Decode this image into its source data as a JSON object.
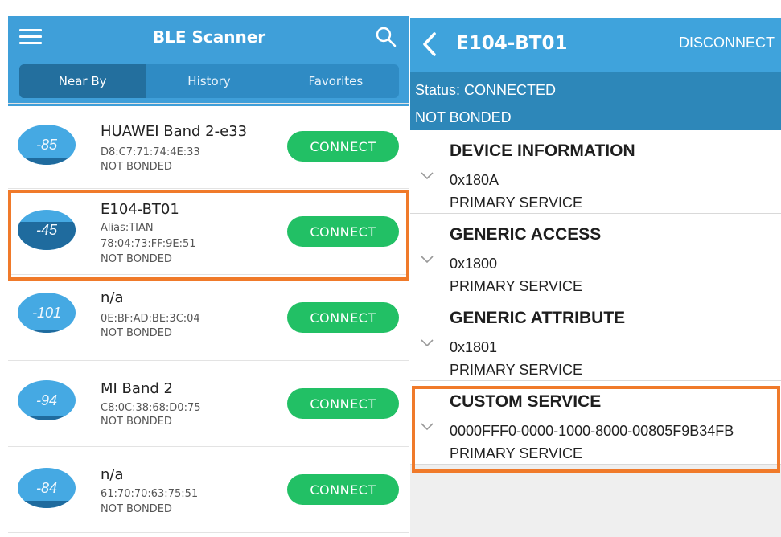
{
  "left_panel": {
    "app_title": "BLE Scanner",
    "tabs": [
      {
        "label": "Near By",
        "active": true
      },
      {
        "label": "History",
        "active": false
      },
      {
        "label": "Favorites",
        "active": false
      }
    ],
    "devices": [
      {
        "rssi": "-85",
        "name": "HUAWEI Band 2-e33",
        "lines": [
          "D8:C7:71:74:4E:33",
          "NOT BONDED"
        ],
        "button": "CONNECT"
      },
      {
        "rssi": "-45",
        "name": "E104-BT01",
        "lines": [
          "Alias:TIAN",
          "78:04:73:FF:9E:51",
          "NOT BONDED"
        ],
        "button": "CONNECT",
        "highlighted": true
      },
      {
        "rssi": "-101",
        "name": "n/a",
        "lines": [
          "0E:BF:AD:BE:3C:04",
          "NOT BONDED"
        ],
        "button": "CONNECT"
      },
      {
        "rssi": "-94",
        "name": "MI Band 2",
        "lines": [
          "C8:0C:38:68:D0:75",
          "NOT BONDED"
        ],
        "button": "CONNECT"
      },
      {
        "rssi": "-84",
        "name": "n/a",
        "lines": [
          "61:70:70:63:75:51",
          "NOT BONDED"
        ],
        "button": "CONNECT"
      }
    ]
  },
  "right_panel": {
    "device_title": "E104-BT01",
    "disconnect_label": "DISCONNECT",
    "status": "Status: CONNECTED",
    "bond": "NOT BONDED",
    "services": [
      {
        "title": "DEVICE INFORMATION",
        "uuid": "0x180A",
        "type": "PRIMARY SERVICE"
      },
      {
        "title": "GENERIC ACCESS",
        "uuid": "0x1800",
        "type": "PRIMARY SERVICE"
      },
      {
        "title": "GENERIC ATTRIBUTE",
        "uuid": "0x1801",
        "type": "PRIMARY SERVICE"
      },
      {
        "title": "CUSTOM SERVICE",
        "uuid": "0000FFF0-0000-1000-8000-00805F9B34FB",
        "type": "PRIMARY SERVICE",
        "highlighted": true
      }
    ]
  },
  "colors": {
    "accent": "#3f9fd9",
    "status_bar": "#2d87b9",
    "connect_button": "#22c065",
    "highlight": "#f07a2a"
  }
}
